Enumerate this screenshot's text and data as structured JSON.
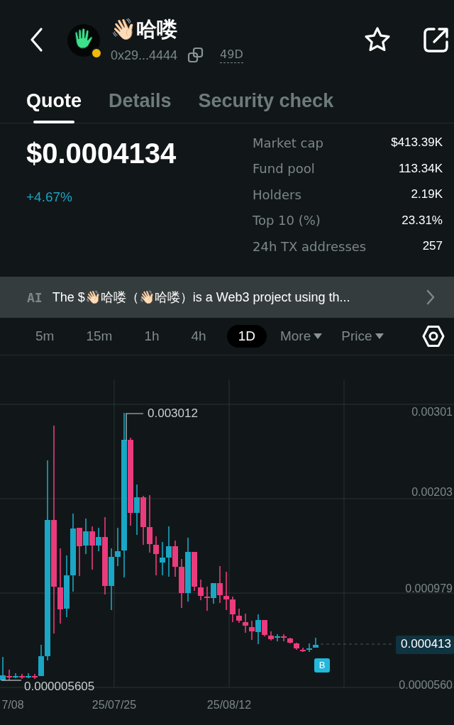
{
  "token": {
    "name": "👋🏻哈喽",
    "address": "0x29...4444",
    "age": "49D"
  },
  "tabs": [
    {
      "label": "Quote",
      "selected": true
    },
    {
      "label": "Details",
      "selected": false
    },
    {
      "label": "Security check",
      "selected": false
    }
  ],
  "price": "$0.0004134",
  "change": "+4.67%",
  "stats": [
    {
      "label": "Market cap",
      "value": "$413.39K"
    },
    {
      "label": "Fund pool",
      "value": "113.34K"
    },
    {
      "label": "Holders",
      "value": "2.19K"
    },
    {
      "label": "Top 10 (%)",
      "value": "23.31%"
    },
    {
      "label": "24h TX addresses",
      "value": "257"
    }
  ],
  "ai_summary": {
    "badge": "AI",
    "text": "The $👋🏻哈喽（👋🏻哈喽）is a Web3 project using th..."
  },
  "intervals": [
    {
      "kind": "interval",
      "label": "5m",
      "selected": false
    },
    {
      "kind": "interval",
      "label": "15m",
      "selected": false
    },
    {
      "kind": "interval",
      "label": "1h",
      "selected": false
    },
    {
      "kind": "interval",
      "label": "4h",
      "selected": false
    },
    {
      "kind": "interval",
      "label": "1D",
      "selected": true
    },
    {
      "kind": "dropdown",
      "label": "More",
      "selected": false
    },
    {
      "kind": "dropdown",
      "label": "Price",
      "selected": false
    }
  ],
  "chart": {
    "y_labels": [
      "0.00301",
      "0.00203",
      "0.000979",
      "0.0000560"
    ],
    "x_labels": [
      "7/08",
      "25/07/25",
      "25/08/12"
    ],
    "high_label": "0.003012",
    "low_label": "0.000005605",
    "current_price": "0.000413",
    "marker": "B"
  }
}
